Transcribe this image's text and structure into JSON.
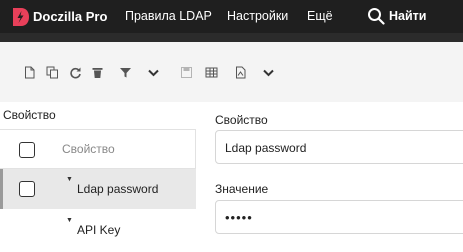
{
  "navbar": {
    "brand": "Doczilla Pro",
    "items": [
      "Правила LDAP",
      "Настройки",
      "Ещё"
    ],
    "search_label": "Найти",
    "brand_color": "#e8405a"
  },
  "toolbar": {
    "icons": [
      "new-document-icon",
      "copy-icon",
      "refresh-icon",
      "delete-icon",
      "filter-icon",
      "chevron-down-icon",
      "save-icon",
      "table-icon",
      "export-icon",
      "chevron-down-icon"
    ]
  },
  "list": {
    "title": "Свойство",
    "column_header": "Свойство",
    "rows": [
      {
        "label": "Ldap password",
        "selected": true
      },
      {
        "label": "API Key",
        "selected": false
      }
    ]
  },
  "detail": {
    "property_label": "Свойство",
    "property_value": "Ldap password",
    "value_label": "Значение",
    "value_masked": "•••••"
  }
}
